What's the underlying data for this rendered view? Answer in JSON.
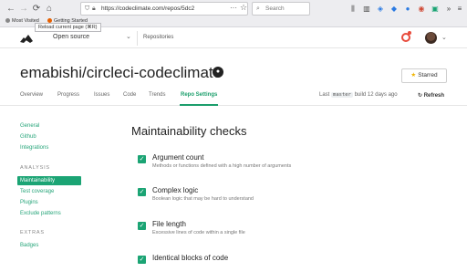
{
  "browser": {
    "url": "https://codeclimate.com/repos/5dc2",
    "search_placeholder": "Search",
    "bookmarks": [
      "Most Visited",
      "Getting Started"
    ],
    "tooltip": "Reload current page (⌘R)"
  },
  "app_header": {
    "org_name": "Open source",
    "repositories_link": "Repositories"
  },
  "repo": {
    "title": "emabishi/circleci-codeclimate",
    "starred_label": "Starred"
  },
  "tabs": [
    {
      "label": "Overview"
    },
    {
      "label": "Progress"
    },
    {
      "label": "Issues"
    },
    {
      "label": "Code"
    },
    {
      "label": "Trends"
    },
    {
      "label": "Repo Settings",
      "active": true
    }
  ],
  "build_info": {
    "last_label": "Last",
    "branch": "master",
    "build_text": "build 12 days ago",
    "refresh_label": "Refresh"
  },
  "sidebar": {
    "top_links": [
      "General",
      "Github",
      "Integrations"
    ],
    "analysis_heading": "ANALYSIS",
    "analysis_links": [
      "Maintainability",
      "Test coverage",
      "Plugins",
      "Exclude patterns"
    ],
    "active_item": "Maintainability",
    "extras_heading": "EXTRAS",
    "extras_links": [
      "Badges"
    ]
  },
  "main": {
    "title": "Maintainability checks",
    "checks": [
      {
        "name": "Argument count",
        "description": "Methods or functions defined with a high number of arguments",
        "checked": true
      },
      {
        "name": "Complex logic",
        "description": "Boolean logic that may be hard to understand",
        "checked": true
      },
      {
        "name": "File length",
        "description": "Excessive lines of code within a single file",
        "checked": true
      },
      {
        "name": "Identical blocks of code",
        "description": "",
        "checked": true
      }
    ]
  },
  "colors": {
    "accent": "#1ba474",
    "alert": "#e84b3c",
    "star": "#f0b400"
  },
  "icons": [
    "back-icon",
    "forward-icon",
    "reload-icon",
    "home-icon",
    "lock-icon",
    "search-icon",
    "github-icon",
    "star-icon",
    "refresh-icon",
    "check-icon"
  ]
}
